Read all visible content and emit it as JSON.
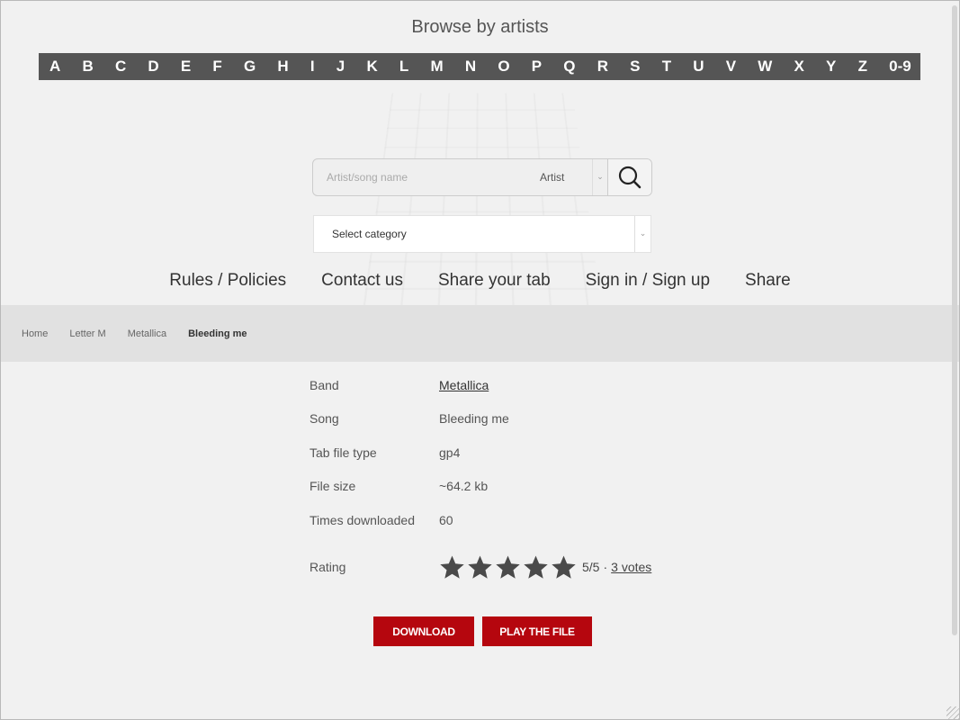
{
  "browse": {
    "title": "Browse by artists",
    "letters": [
      "A",
      "B",
      "C",
      "D",
      "E",
      "F",
      "G",
      "H",
      "I",
      "J",
      "K",
      "L",
      "M",
      "N",
      "O",
      "P",
      "Q",
      "R",
      "S",
      "T",
      "U",
      "V",
      "W",
      "X",
      "Y",
      "Z",
      "0-9"
    ]
  },
  "search": {
    "placeholder": "Artist/song name",
    "type_selected": "Artist",
    "button_icon": "search-icon"
  },
  "category": {
    "selected": "Select category"
  },
  "nav": {
    "rules": "Rules / Policies",
    "contact": "Contact us",
    "share_tab": "Share your tab",
    "signin": "Sign in / Sign up",
    "share": "Share"
  },
  "breadcrumb": {
    "home": "Home",
    "letter": "Letter M",
    "artist": "Metallica",
    "current": "Bleeding me"
  },
  "details": {
    "band_label": "Band",
    "band_value": "Metallica",
    "song_label": "Song",
    "song_value": "Bleeding me",
    "type_label": "Tab file type",
    "type_value": "gp4",
    "size_label": "File size",
    "size_value": "~64.2 kb",
    "downloads_label": "Times downloaded",
    "downloads_value": "60"
  },
  "rating": {
    "label": "Rating",
    "stars_filled": 5,
    "stars_total": 5,
    "score": "5/5",
    "separator": "·",
    "votes": "3 votes"
  },
  "actions": {
    "download": "DOWNLOAD",
    "play": "PLAY THE FILE"
  },
  "colors": {
    "accent": "#b5060e",
    "letter_bar": "#555555",
    "star": "#4a4a4a"
  }
}
